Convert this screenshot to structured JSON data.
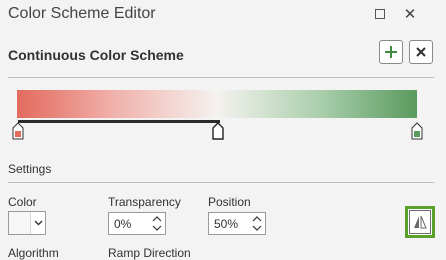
{
  "window": {
    "title": "Color Scheme Editor",
    "restore_glyph": "restore-icon",
    "close_glyph": "✕"
  },
  "header": {
    "title": "Continuous Color Scheme",
    "add_icon": "plus-icon",
    "remove_icon": "x-icon"
  },
  "ramp": {
    "stops": [
      {
        "position": 0,
        "color": "#e46a5d"
      },
      {
        "position": 50,
        "color": "#f5f2ef"
      },
      {
        "position": 100,
        "color": "#5a9a5e"
      }
    ],
    "selected_stop": 1
  },
  "settings": {
    "section_label": "Settings",
    "color_label": "Color",
    "transparency_label": "Transparency",
    "transparency_value": "0%",
    "position_label": "Position",
    "position_value": "50%",
    "flip_icon": "flip-triangle-icon",
    "algorithm_label": "Algorithm",
    "ramp_direction_label": "Ramp Direction"
  },
  "colors": {
    "accent": "#5aa02c",
    "brand_green": "#3e8a3e"
  }
}
